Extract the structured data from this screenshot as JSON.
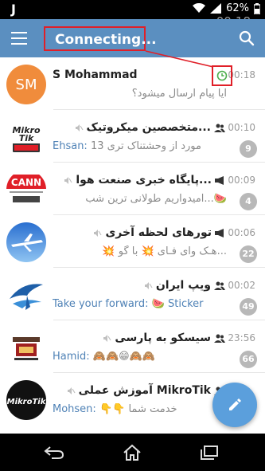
{
  "status_bar": {
    "left_glyph": "J",
    "battery": "62%",
    "time": "00:18"
  },
  "app_bar": {
    "title": "Connecting..."
  },
  "chats": [
    {
      "name": "S Mohammad",
      "time": "00:18",
      "sender": "",
      "message": "آیا پیام ارسال میشود؟",
      "unread": "",
      "avatar_text": "SM",
      "avatar_color": "#f08c3c",
      "type": "user",
      "muted": false,
      "status_icon": "clock-icon"
    },
    {
      "name": "متخصصین میکروتیک...",
      "time": "00:10",
      "sender": "Ehsan:",
      "message": "مورد از وحشتناک تری 13",
      "unread": "9",
      "avatar_text": "Mikro Tik",
      "type": "group",
      "muted": true
    },
    {
      "name": "پایگاه خبری صنعت هوا...",
      "time": "00:09",
      "sender": "",
      "message": "امیدواریم طولانی ترین شب...🍉",
      "unread": "4",
      "avatar_text": "CANN",
      "type": "channel",
      "muted": true
    },
    {
      "name": "تورهای لحظه آخری",
      "time": "00:06",
      "sender": "",
      "message": "💥 هـک وای فـای 💥 با گو...",
      "unread": "22",
      "avatar_text": "",
      "type": "channel",
      "muted": true
    },
    {
      "name": "ویپ ایران",
      "time": "00:02",
      "sender": "Take your forward:",
      "message": "🍉 Sticker",
      "unread": "49",
      "avatar_text": "",
      "type": "group",
      "muted": true
    },
    {
      "name": "سیسکو به پارسی",
      "time": "23:56",
      "sender": "Hamid:",
      "message": "🙈🙈😁🙈🙈",
      "unread": "66",
      "avatar_text": "",
      "type": "group",
      "muted": true
    },
    {
      "name": "آموزش عملی MikroTik",
      "time": "",
      "sender": "Mohsen:",
      "message": "👇👇 خدمت شما",
      "unread": "",
      "avatar_text": "MikroTik",
      "type": "group",
      "muted": true
    }
  ],
  "colors": {
    "primary": "#5b8fc0",
    "highlight": "#e01f28",
    "fab": "#5b9fdc",
    "badge": "#b8b8b8"
  }
}
